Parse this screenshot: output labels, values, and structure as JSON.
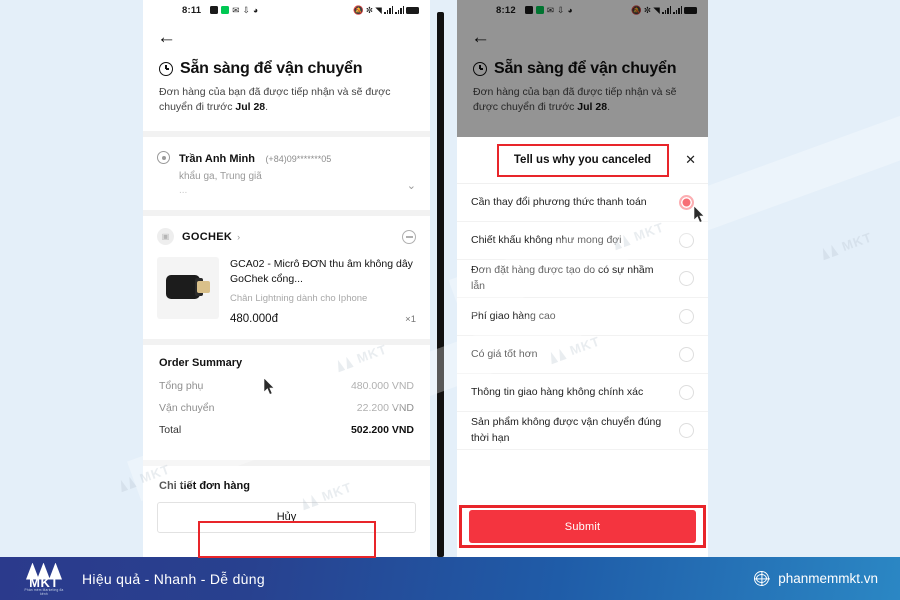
{
  "left_phone": {
    "status_bar": {
      "time": "8:11",
      "left_icons": [
        "battery-saver-icon",
        "screen-record-icon",
        "mail-icon",
        "download-icon",
        "alarm-icon"
      ],
      "right_icons": [
        "notification-off-icon",
        "bluetooth-icon",
        "wifi-icon",
        "signal-1-icon",
        "signal-2-icon",
        "battery-icon"
      ]
    },
    "back_label": "←",
    "hero": {
      "title": "Sẵn sàng để vận chuyển",
      "sub_prefix": "Đơn hàng của bạn đã được tiếp nhận và sẽ được chuyển đi trước ",
      "sub_date": "Jul 28",
      "sub_suffix": "."
    },
    "address": {
      "name": "Trần Anh Minh",
      "phone": "(+84)09*******05",
      "line2": "khẩu ga, Trung giã",
      "line3": "..."
    },
    "shop": {
      "name": "GOCHEK",
      "chevron": "›"
    },
    "product": {
      "title": "GCA02 - Micrô ĐƠN thu âm không dây GoChek cổng...",
      "variant": "Chân Lightning dành cho Iphone",
      "price": "480.000đ",
      "qty": "×1"
    },
    "summary": {
      "heading": "Order Summary",
      "rows": [
        {
          "label": "Tổng phụ",
          "value": "480.000 VND"
        },
        {
          "label": "Vận chuyển",
          "value": "22.200 VND"
        },
        {
          "label": "Total",
          "value": "502.200 VND"
        }
      ]
    },
    "details_heading": "Chi tiết đơn hàng",
    "cancel_button": "Hủy"
  },
  "right_phone": {
    "status_bar": {
      "time": "8:12"
    },
    "back_label": "←",
    "hero": {
      "title": "Sẵn sàng để vận chuyển",
      "sub_prefix": "Đơn hàng của bạn đã được tiếp nhận và sẽ được chuyển đi trước ",
      "sub_date": "Jul 28",
      "sub_suffix": "."
    },
    "sheet": {
      "title": "Tell us why you canceled",
      "close_label": "✕",
      "reasons": [
        {
          "label": "Cần thay đổi phương thức thanh toán",
          "selected": true
        },
        {
          "label": "Chiết khấu không như mong đợi",
          "selected": false
        },
        {
          "label": "Đơn đặt hàng được tạo do có sự nhầm lẫn",
          "selected": false
        },
        {
          "label": "Phí giao hàng cao",
          "selected": false
        },
        {
          "label": "Có giá tốt hơn",
          "selected": false
        },
        {
          "label": "Thông tin giao hàng không chính xác",
          "selected": false
        },
        {
          "label": "Sản phẩm không được vận chuyển đúng thời hạn",
          "selected": false
        }
      ],
      "submit_label": "Submit"
    }
  },
  "watermarks": {
    "text": "MKT",
    "count": 5
  },
  "footer": {
    "logo_text": "MKT",
    "logo_sub": "Phần mềm Marketing đa kênh",
    "tagline": "Hiệu quả - Nhanh - Dễ dùng",
    "site": "phanmemmkt.vn"
  },
  "colors": {
    "highlight_red": "#e8252a",
    "submit_red": "#f4343f",
    "footer_blue_start": "#2b3a8c",
    "footer_blue_end": "#2b87c4",
    "page_bg": "#e4eff9"
  }
}
